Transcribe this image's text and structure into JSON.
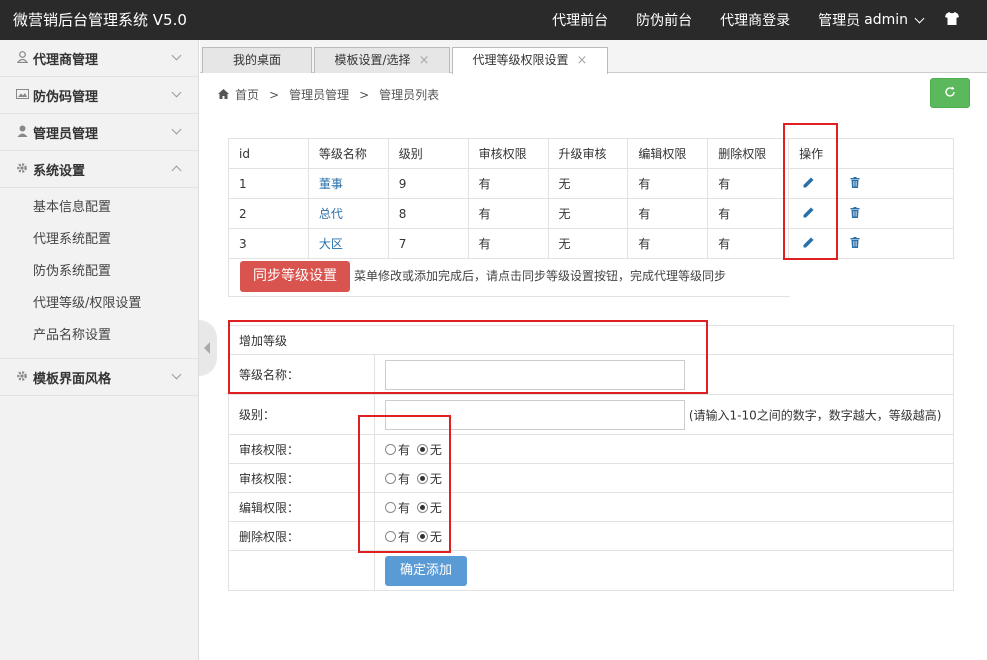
{
  "header": {
    "brand": "微营销后台管理系统 V5.0",
    "nav": [
      "代理前台",
      "防伪前台",
      "代理商登录"
    ],
    "role_label": "管理员",
    "username": "admin"
  },
  "sidebar": {
    "groups": [
      {
        "label": "代理商管理",
        "icon": "user-icon"
      },
      {
        "label": "防伪码管理",
        "icon": "image-icon"
      },
      {
        "label": "管理员管理",
        "icon": "admin-icon"
      },
      {
        "label": "系统设置",
        "icon": "gear-icon"
      },
      {
        "label": "模板界面风格",
        "icon": "gear-icon"
      }
    ],
    "system_sub": [
      "基本信息配置",
      "代理系统配置",
      "防伪系统配置",
      "代理等级/权限设置",
      "产品名称设置"
    ]
  },
  "tabs": [
    {
      "label": "我的桌面"
    },
    {
      "label": "模板设置/选择"
    },
    {
      "label": "代理等级权限设置"
    }
  ],
  "breadcrumb": [
    "首页",
    "管理员管理",
    "管理员列表"
  ],
  "table": {
    "headers": [
      "id",
      "等级名称",
      "级别",
      "审核权限",
      "升级审核",
      "编辑权限",
      "删除权限",
      "操作"
    ],
    "rows": [
      {
        "id": "1",
        "name": "董事",
        "level": "9",
        "audit": "有",
        "upgrade": "无",
        "edit": "有",
        "delete": "有"
      },
      {
        "id": "2",
        "name": "总代",
        "level": "8",
        "audit": "有",
        "upgrade": "无",
        "edit": "有",
        "delete": "有"
      },
      {
        "id": "3",
        "name": "大区",
        "level": "7",
        "audit": "有",
        "upgrade": "无",
        "edit": "有",
        "delete": "有"
      }
    ]
  },
  "sync": {
    "button": "同步等级设置",
    "note": "菜单修改或添加完成后，请点击同步等级设置按钮，完成代理等级同步"
  },
  "form": {
    "title": "增加等级",
    "name_label": "等级名称：",
    "level_label": "级别：",
    "level_hint": "(请输入1-10之间的数字，数字越大，等级越高)",
    "perm_rows": [
      {
        "label": "审核权限："
      },
      {
        "label": "审核权限："
      },
      {
        "label": "编辑权限："
      },
      {
        "label": "删除权限："
      }
    ],
    "opt_yes": "有",
    "opt_no": "无",
    "selected": "无",
    "submit": "确定添加"
  },
  "colors": {
    "topbar": "#2a2a2a",
    "danger": "#d9534f",
    "primary": "#5b9bd5",
    "success": "#5cb85c",
    "highlight": "#e02020"
  }
}
